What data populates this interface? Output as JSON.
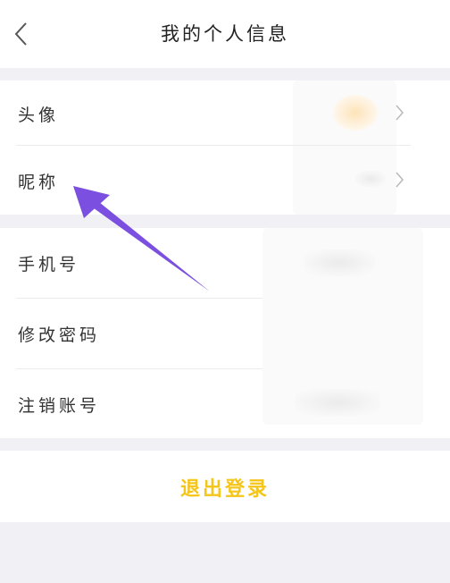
{
  "header": {
    "title": "我的个人信息"
  },
  "profile": {
    "items": [
      {
        "label": "头像"
      },
      {
        "label": "昵称"
      }
    ]
  },
  "account": {
    "items": [
      {
        "label": "手机号"
      },
      {
        "label": "修改密码"
      },
      {
        "label": "注销账号"
      }
    ]
  },
  "actions": {
    "logout_label": "退出登录"
  },
  "colors": {
    "accent": "#f5c518",
    "annotation_arrow": "#7b4fe0",
    "background": "#f0f0f5"
  },
  "icons": {
    "back": "chevron-left-icon",
    "row_arrow": "chevron-right-icon"
  }
}
